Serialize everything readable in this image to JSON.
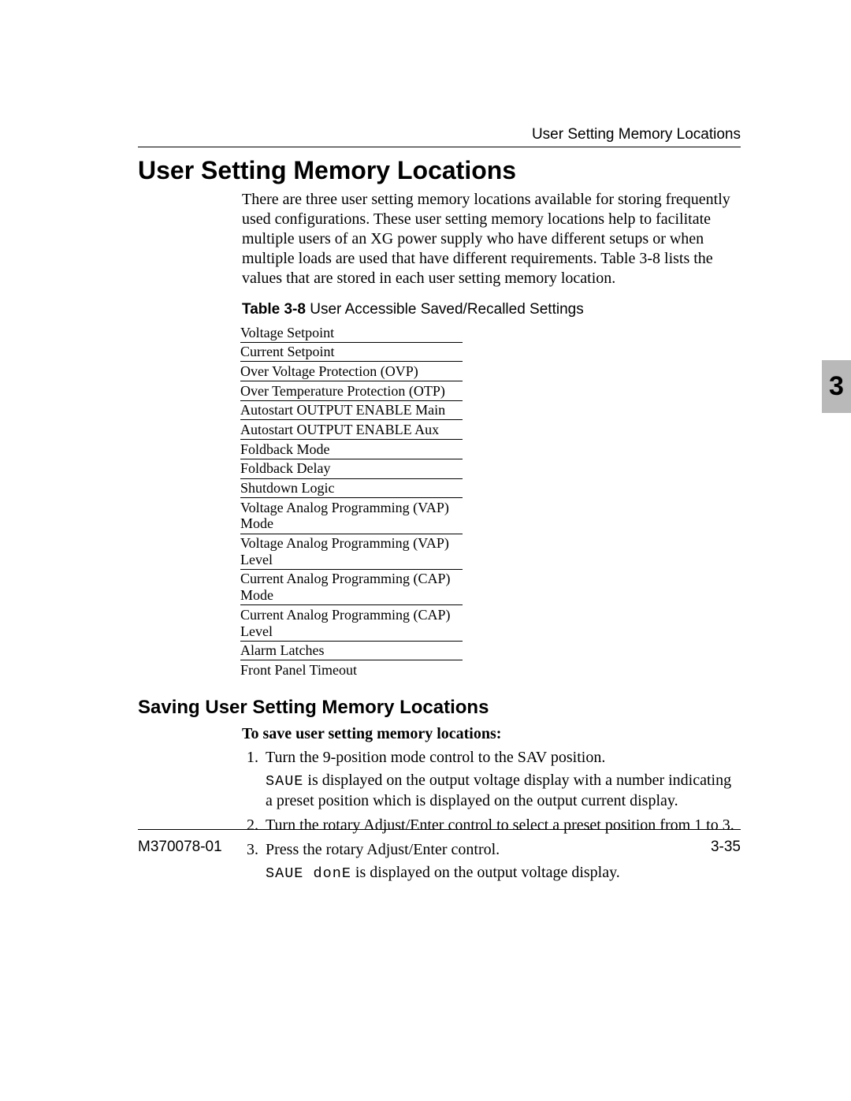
{
  "runningHead": "User Setting Memory Locations",
  "chapterTab": "3",
  "title": "User Setting Memory Locations",
  "intro": "There are three user setting memory locations available for storing frequently used configurations. These user setting memory locations help to facilitate multiple users of an XG power supply who have different setups or when multiple loads are used that have different requirements. Table 3-8 lists the values that are stored in each user setting memory location.",
  "tableCaptionBold": "Table 3-8",
  "tableCaptionRest": "  User Accessible Saved/Recalled Settings",
  "tableRows": [
    "Voltage Setpoint",
    "Current Setpoint",
    "Over Voltage Protection (OVP)",
    "Over Temperature Protection (OTP)",
    "Autostart OUTPUT ENABLE Main",
    "Autostart OUTPUT ENABLE Aux",
    "Foldback Mode",
    "Foldback Delay",
    "Shutdown Logic",
    "Voltage Analog Programming (VAP) Mode",
    "Voltage Analog Programming (VAP) Level",
    "Current Analog Programming (CAP) Mode",
    "Current Analog Programming (CAP) Level",
    "Alarm Latches",
    "Front Panel Timeout"
  ],
  "subtitle": "Saving User Setting Memory Locations",
  "instruction": "To save user setting memory locations:",
  "step1": "Turn the 9-position mode control to the SAV position.",
  "step1_seg": "SAUE",
  "step1_tail": " is displayed on the output voltage display with a number indicating a preset position which is displayed on the output current display.",
  "step2": "Turn the rotary Adjust/Enter control to select a preset position from 1 to 3.",
  "step3": "Press the rotary Adjust/Enter control.",
  "step3_seg": "SAUE donE",
  "step3_tail": " is displayed on the output voltage display.",
  "footerLeft": "M370078-01",
  "footerRight": "3-35"
}
